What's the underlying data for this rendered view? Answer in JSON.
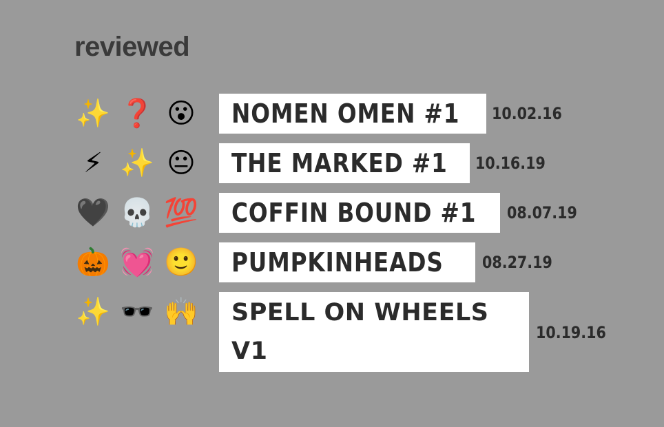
{
  "heading": "reviewed",
  "items": [
    {
      "emojis": [
        "✨",
        "❓",
        "😮"
      ],
      "emoji_names": [
        "sparkles-icon",
        "question-mark-icon",
        "surprised-face-icon"
      ],
      "title": "NOMEN OMEN #1",
      "date": "10.02.16"
    },
    {
      "emojis": [
        "⚡",
        "✨",
        "😐"
      ],
      "emoji_names": [
        "lightning-icon",
        "sparkles-icon",
        "neutral-face-icon"
      ],
      "title": "THE MARKED #1",
      "date": "10.16.19"
    },
    {
      "emojis": [
        "🖤",
        "💀",
        "💯"
      ],
      "emoji_names": [
        "black-heart-icon",
        "skull-icon",
        "hundred-points-icon"
      ],
      "title": "COFFIN BOUND #1",
      "date": "08.07.19"
    },
    {
      "emojis": [
        "🎃",
        "💓",
        "🙂"
      ],
      "emoji_names": [
        "jack-o-lantern-icon",
        "beating-heart-icon",
        "slightly-smiling-face-icon"
      ],
      "title": "PUMPKINHEADS",
      "date": "08.27.19"
    },
    {
      "emojis": [
        "✨",
        "🕶️",
        "🙌"
      ],
      "emoji_names": [
        "sparkles-icon",
        "sunglasses-icon",
        "raising-hands-icon"
      ],
      "title": "SPELL ON WHEELS V1",
      "date": "10.19.16"
    }
  ]
}
